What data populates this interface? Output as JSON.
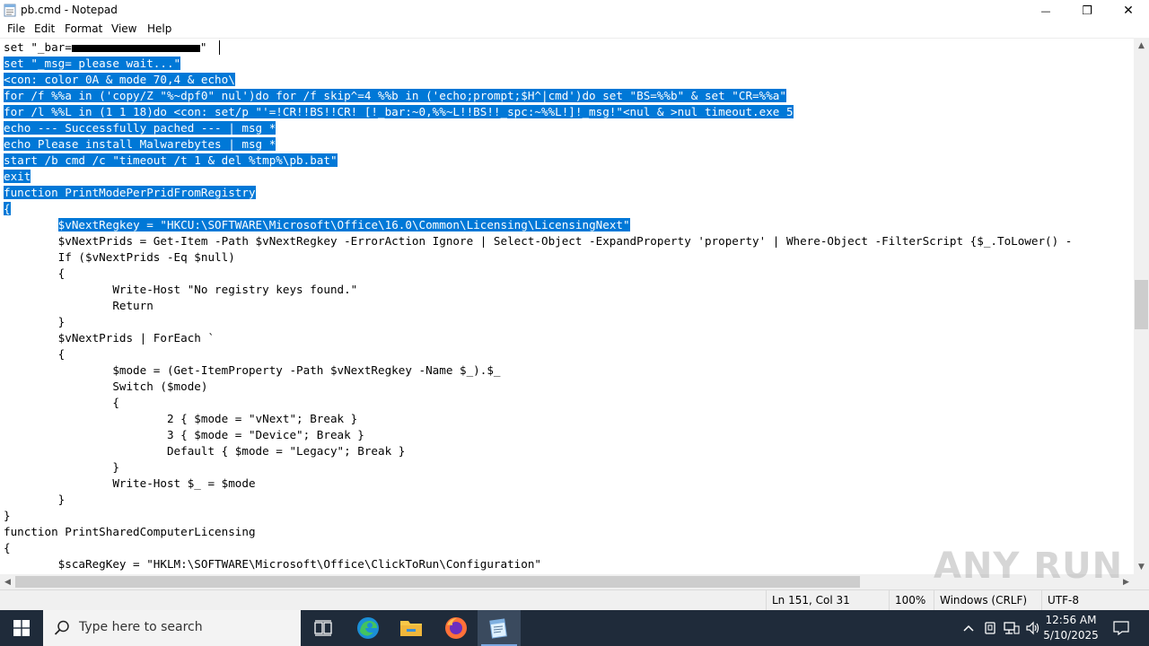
{
  "window": {
    "title": "pb.cmd - Notepad",
    "buttons": {
      "minimize": "—",
      "maximize": "❐",
      "close": "✕"
    }
  },
  "menu": [
    "File",
    "Edit",
    "Format",
    "View",
    "Help"
  ],
  "editor": {
    "lines": [
      {
        "pre": "set \"_bar=",
        "redacted": true,
        "post": "\" "
      },
      {
        "sel": "set \"_msg= please wait...\""
      },
      {
        "sel": "<con: color 0A & mode 70,4 & echo\\"
      },
      {
        "sel": "for /f %%a in ('copy/Z \"%~dpf0\" nul')do for /f skip^=4 %%b in ('echo;prompt;$H^|cmd')do set \"BS=%%b\" & set \"CR=%%a\""
      },
      {
        "sel": "for /l %%L in (1 1 18)do <con: set/p \"'=!CR!!BS!!CR! [!_bar:~0,%%~L!!BS!!_spc:~%%L!]!_msg!\"<nul & >nul timeout.exe 5"
      },
      {
        "sel": "echo --- Successfully pached --- | msg *"
      },
      {
        "sel": "echo Please install Malwarebytes | msg *"
      },
      {
        "sel": "start /b cmd /c \"timeout /t 1 & del %tmp%\\pb.bat\""
      },
      {
        "sel": "exit"
      },
      {
        "sel": "function PrintModePerPridFromRegistry"
      },
      {
        "sel": "{"
      },
      {
        "pre": "        ",
        "sel": "$vNextRegkey = \"HKCU:\\SOFTWARE\\Microsoft\\Office\\16.0\\Common\\Licensing\\LicensingNext\""
      },
      {
        "pre": "        $vNextPrids = Get-Item -Path $vNextRegkey -ErrorAction Ignore | Select-Object -ExpandProperty 'property' | Where-Object -FilterScript {$_.ToLower() -"
      },
      {
        "pre": "        If ($vNextPrids -Eq $null)"
      },
      {
        "pre": "        {"
      },
      {
        "pre": "                Write-Host \"No registry keys found.\""
      },
      {
        "pre": "                Return"
      },
      {
        "pre": "        }"
      },
      {
        "pre": "        $vNextPrids | ForEach `"
      },
      {
        "pre": "        {"
      },
      {
        "pre": "                $mode = (Get-ItemProperty -Path $vNextRegkey -Name $_).$_"
      },
      {
        "pre": "                Switch ($mode)"
      },
      {
        "pre": "                {"
      },
      {
        "pre": "                        2 { $mode = \"vNext\"; Break }"
      },
      {
        "pre": "                        3 { $mode = \"Device\"; Break }"
      },
      {
        "pre": "                        Default { $mode = \"Legacy\"; Break }"
      },
      {
        "pre": "                }"
      },
      {
        "pre": "                Write-Host $_ = $mode"
      },
      {
        "pre": "        }"
      },
      {
        "pre": "}"
      },
      {
        "pre": "function PrintSharedComputerLicensing"
      },
      {
        "pre": "{"
      },
      {
        "pre": "        $scaRegKey = \"HKLM:\\SOFTWARE\\Microsoft\\Office\\ClickToRun\\Configuration\""
      }
    ]
  },
  "statusbar": {
    "position": "Ln 151, Col 31",
    "zoom": "100%",
    "line_ending": "Windows (CRLF)",
    "encoding": "UTF-8"
  },
  "watermark": "ANY RUN",
  "taskbar": {
    "search_placeholder": "Type here to search",
    "time": "12:56 AM",
    "date": "5/10/2025",
    "pinned": [
      "task-view-icon",
      "edge-icon",
      "file-explorer-icon",
      "firefox-icon",
      "notepad-icon"
    ]
  }
}
